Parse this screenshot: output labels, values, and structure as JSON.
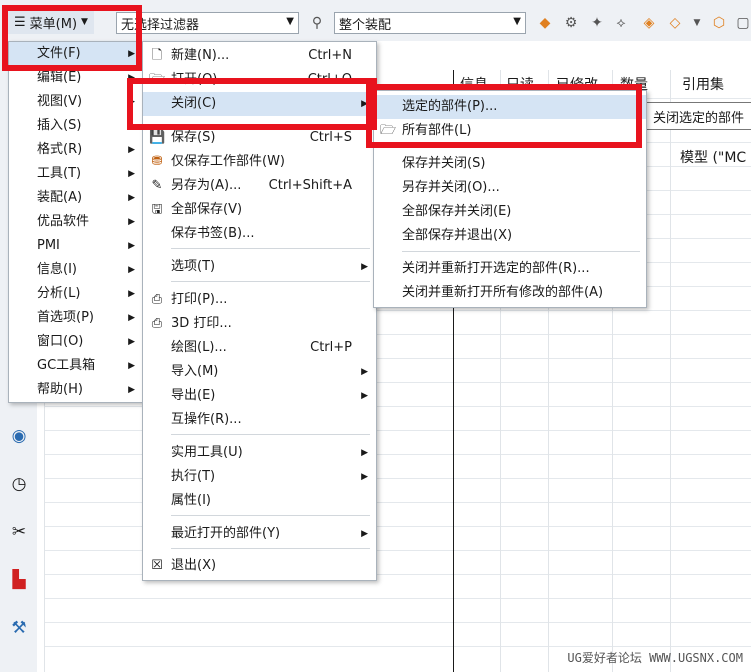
{
  "toolbar": {
    "menu_label": "菜单(M)",
    "filter_value": "无选择过滤器",
    "assembly_value": "整个装配"
  },
  "navigator": {
    "col_info": "信息",
    "col_readonly": "只读",
    "col_modified": "已修改",
    "col_count": "数量",
    "col_refset": "引用集",
    "row1_refset": "模型 (\"MC"
  },
  "main_menu": [
    {
      "label": "文件(F)"
    },
    {
      "label": "编辑(E)"
    },
    {
      "label": "视图(V)"
    },
    {
      "label": "插入(S)"
    },
    {
      "label": "格式(R)"
    },
    {
      "label": "工具(T)"
    },
    {
      "label": "装配(A)"
    },
    {
      "label": "优品软件"
    },
    {
      "label": "PMI"
    },
    {
      "label": "信息(I)"
    },
    {
      "label": "分析(L)"
    },
    {
      "label": "首选项(P)"
    },
    {
      "label": "窗口(O)"
    },
    {
      "label": "GC工具箱"
    },
    {
      "label": "帮助(H)"
    }
  ],
  "file_menu": {
    "new": "新建(N)...",
    "new_sc": "Ctrl+N",
    "open": "打开(O)...",
    "open_sc": "Ctrl+O",
    "close": "关闭(C)",
    "save": "保存(S)",
    "save_sc": "Ctrl+S",
    "save_work_only": "仅保存工作部件(W)",
    "save_as": "另存为(A)...",
    "save_as_sc": "Ctrl+Shift+A",
    "save_all": "全部保存(V)",
    "save_bookmark": "保存书签(B)...",
    "options": "选项(T)",
    "print": "打印(P)...",
    "print3d": "3D 打印...",
    "plot": "绘图(L)...",
    "plot_sc": "Ctrl+P",
    "import": "导入(M)",
    "export": "导出(E)",
    "interop": "互操作(R)...",
    "utilities": "实用工具(U)",
    "execute": "执行(T)",
    "properties": "属性(I)",
    "recent": "最近打开的部件(Y)",
    "exit": "退出(X)"
  },
  "close_menu": {
    "selected_parts": "选定的部件(P)...",
    "all_parts": "所有部件(L)",
    "save_and_close": "保存并关闭(S)",
    "save_as_and_close": "另存并关闭(O)...",
    "save_all_and_close": "全部保存并关闭(E)",
    "save_all_and_exit": "全部保存并退出(X)",
    "close_reopen_selected": "关闭并重新打开选定的部件(R)...",
    "close_reopen_modified": "关闭并重新打开所有修改的部件(A)"
  },
  "tooltip": "关闭选定的部件",
  "watermark": "UG爱好者论坛 WWW.UGSNX.COM"
}
